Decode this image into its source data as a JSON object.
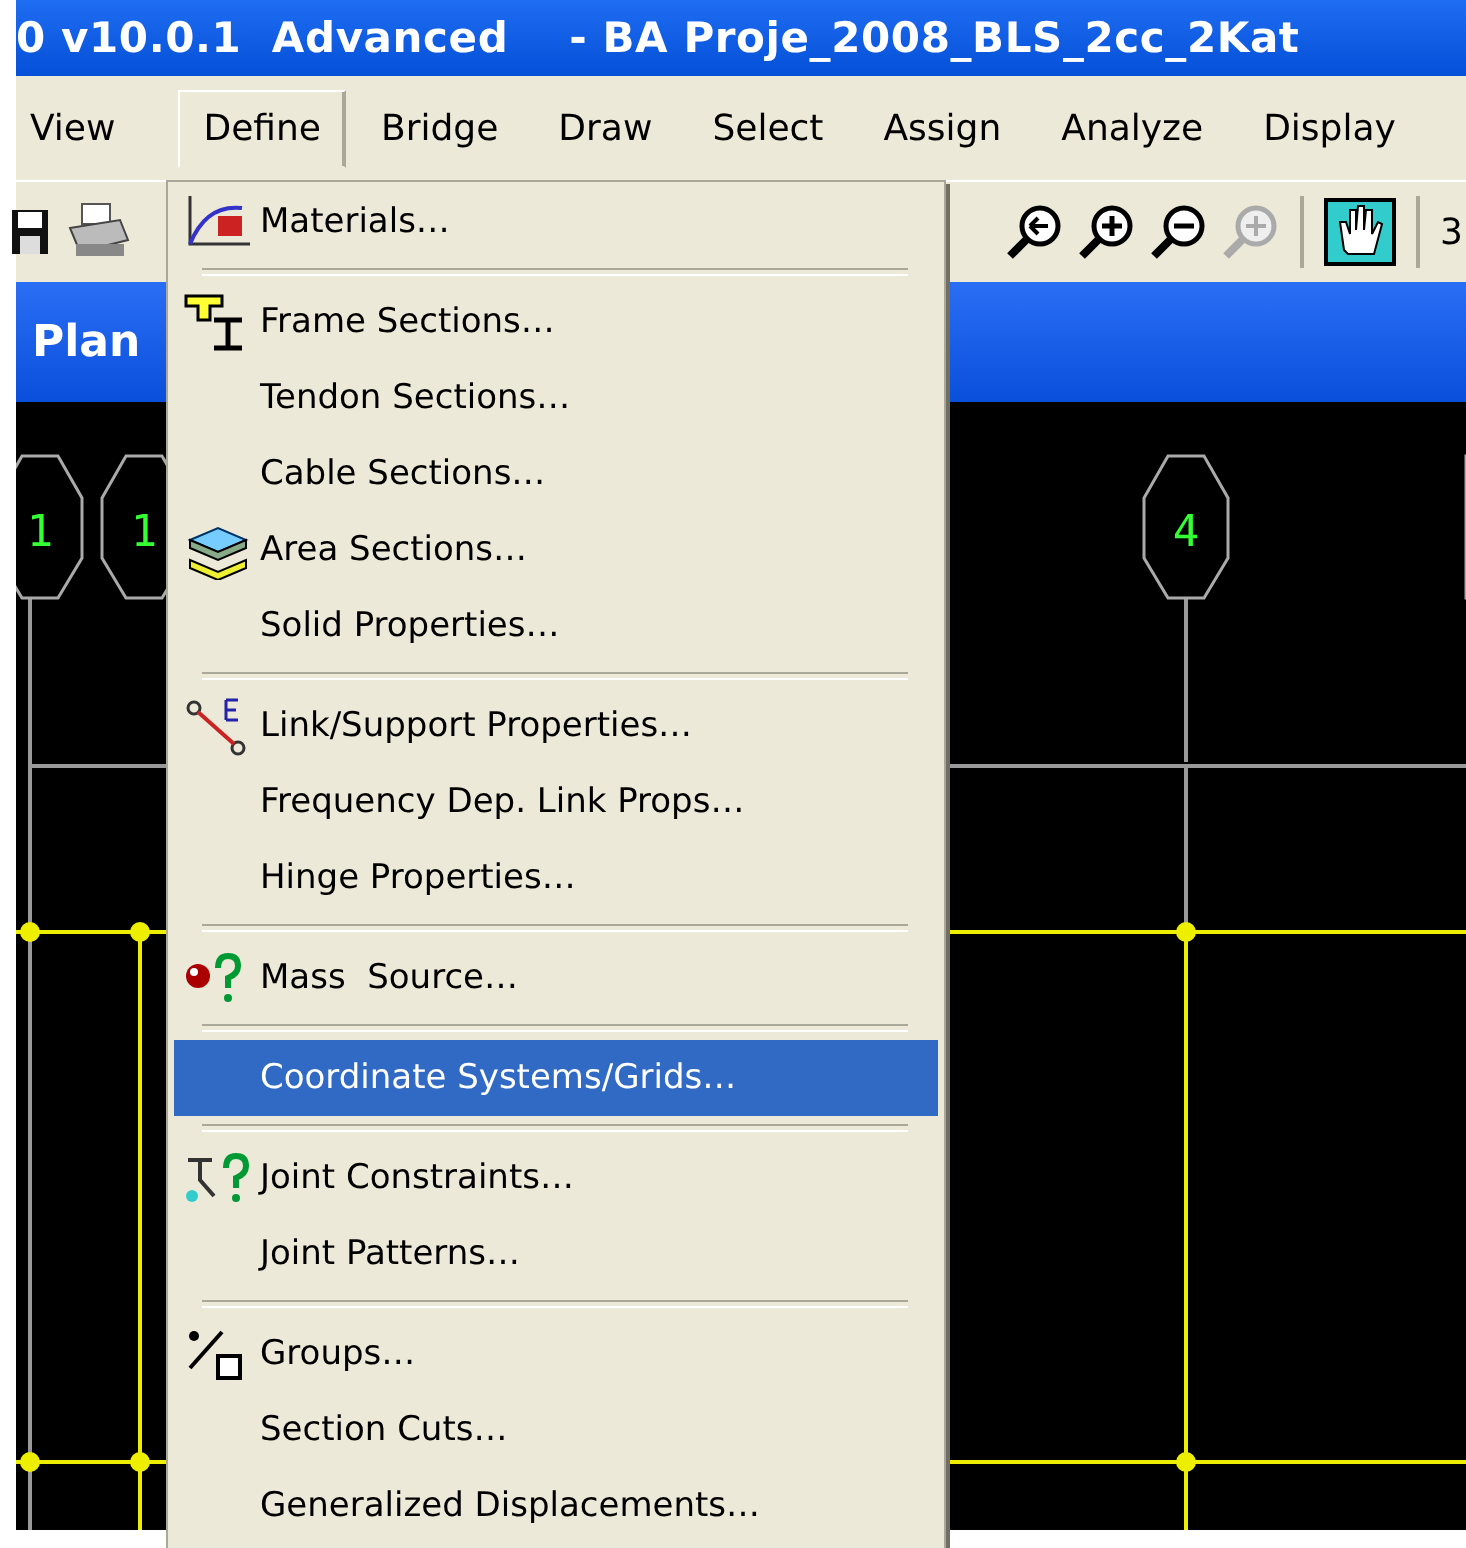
{
  "window": {
    "title": "0 v10.0.1  Advanced    - BA Proje_2008_BLS_2cc_2Kat"
  },
  "menu_bar": [
    {
      "label": "View",
      "selected": false
    },
    {
      "label": "Define",
      "selected": true
    },
    {
      "label": "Bridge",
      "selected": false
    },
    {
      "label": "Draw",
      "selected": false
    },
    {
      "label": "Select",
      "selected": false
    },
    {
      "label": "Assign",
      "selected": false
    },
    {
      "label": "Analyze",
      "selected": false
    },
    {
      "label": "Display",
      "selected": false
    }
  ],
  "toolbar": {
    "text": "3"
  },
  "document": {
    "title": "Plan"
  },
  "canvas": {
    "grid_bubbles": [
      {
        "label": "1"
      },
      {
        "label": "1"
      },
      {
        "label": "4"
      }
    ]
  },
  "define_menu": [
    {
      "kind": "item",
      "label": "Materials…",
      "selected": false
    },
    {
      "kind": "separator"
    },
    {
      "kind": "item",
      "label": "Frame Sections…",
      "selected": false
    },
    {
      "kind": "item",
      "label": "Tendon Sections…",
      "selected": false
    },
    {
      "kind": "item",
      "label": "Cable Sections…",
      "selected": false
    },
    {
      "kind": "item",
      "label": "Area Sections…",
      "selected": false
    },
    {
      "kind": "item",
      "label": "Solid Properties…",
      "selected": false
    },
    {
      "kind": "separator"
    },
    {
      "kind": "item",
      "label": "Link/Support Properties…",
      "selected": false
    },
    {
      "kind": "item",
      "label": "Frequency Dep. Link Props…",
      "selected": false
    },
    {
      "kind": "item",
      "label": "Hinge Properties…",
      "selected": false
    },
    {
      "kind": "separator"
    },
    {
      "kind": "item",
      "label": "Mass  Source…",
      "selected": false
    },
    {
      "kind": "separator"
    },
    {
      "kind": "item",
      "label": "Coordinate Systems/Grids…",
      "selected": true
    },
    {
      "kind": "separator"
    },
    {
      "kind": "item",
      "label": "Joint Constraints…",
      "selected": false
    },
    {
      "kind": "item",
      "label": "Joint Patterns…",
      "selected": false
    },
    {
      "kind": "separator"
    },
    {
      "kind": "item",
      "label": "Groups…",
      "selected": false
    },
    {
      "kind": "item",
      "label": "Section Cuts…",
      "selected": false
    },
    {
      "kind": "item",
      "label": "Generalized Displacements…",
      "selected": false
    }
  ]
}
